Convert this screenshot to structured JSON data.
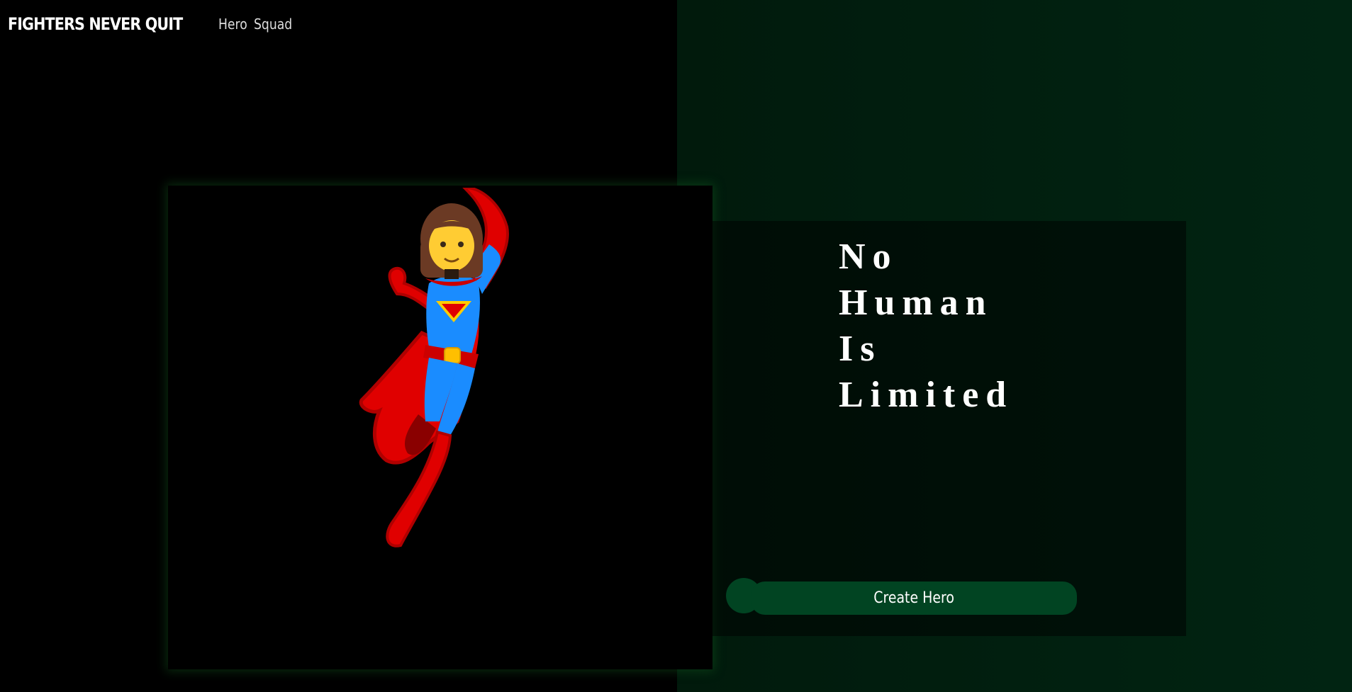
{
  "nav": {
    "brand": "FIGHTERS NEVER QUIT",
    "links": [
      "Hero",
      "Squad"
    ]
  },
  "hero_image": {
    "icon": "superhero-woman-icon"
  },
  "quote": {
    "lines": [
      "No",
      "Human",
      "Is",
      "Limited"
    ]
  },
  "cta": {
    "label": "Create Hero"
  },
  "colors": {
    "background": "#000000",
    "right_panel": "#012412",
    "accent_green": "#014422",
    "text": "#ffffff"
  }
}
